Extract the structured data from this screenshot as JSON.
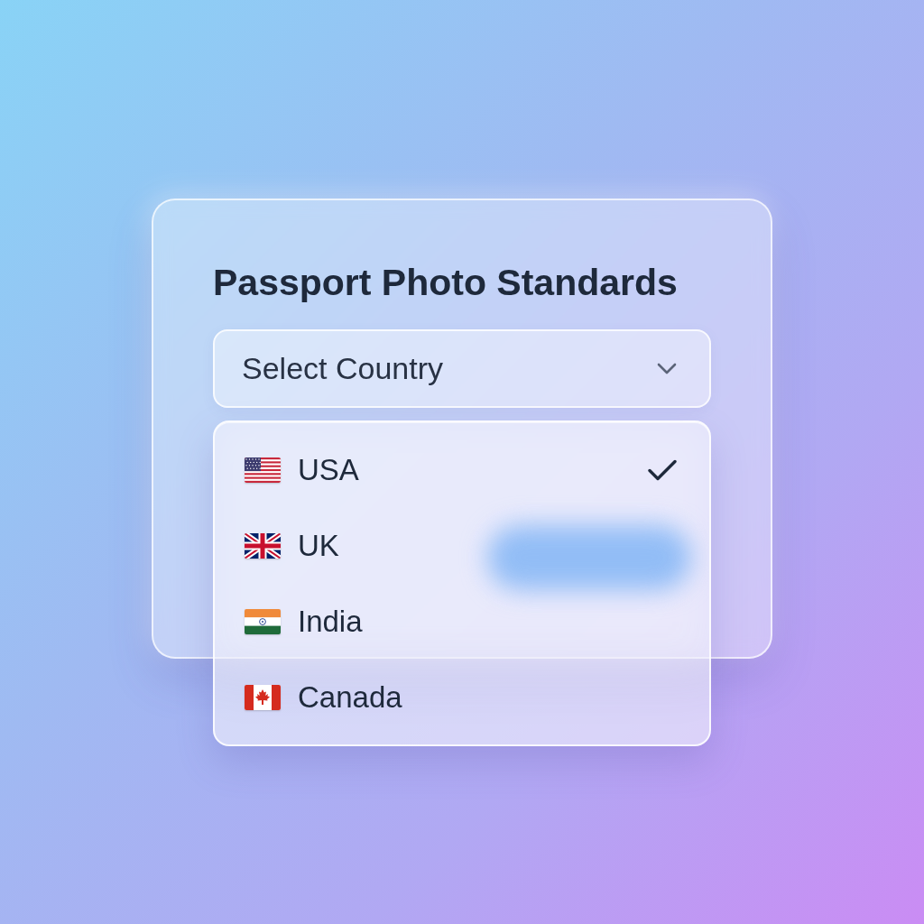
{
  "card": {
    "title": "Passport Photo Standards"
  },
  "country_select": {
    "placeholder": "Select Country",
    "expanded": true,
    "options": [
      {
        "label": "USA",
        "selected": true
      },
      {
        "label": "UK",
        "selected": false
      },
      {
        "label": "India",
        "selected": false
      },
      {
        "label": "Canada",
        "selected": false
      }
    ]
  }
}
